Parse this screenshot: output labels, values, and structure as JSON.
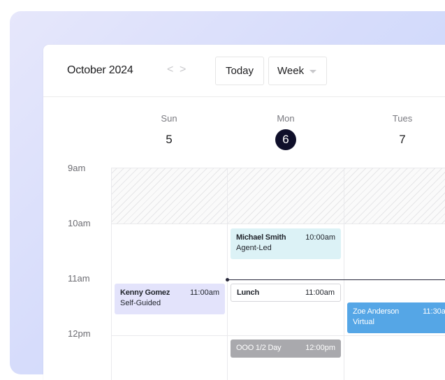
{
  "header": {
    "month_title": "October 2024",
    "prev_glyph": "<",
    "next_glyph": ">",
    "today_label": "Today",
    "view_label": "Week"
  },
  "days": [
    {
      "name": "Sun",
      "number": "5",
      "is_today": false
    },
    {
      "name": "Mon",
      "number": "6",
      "is_today": true
    },
    {
      "name": "Tues",
      "number": "7",
      "is_today": false
    }
  ],
  "time_slots": [
    "9am",
    "10am",
    "11am",
    "12pm"
  ],
  "events": {
    "michael": {
      "name": "Michael Smith",
      "time": "10:00am",
      "type": "Agent-Led"
    },
    "kenny": {
      "name": "Kenny Gomez",
      "time": "11:00am",
      "type": "Self-Guided"
    },
    "lunch": {
      "name": "Lunch",
      "time": "11:00am"
    },
    "zoe": {
      "name": "Zoe Anderson",
      "time": "11:30a",
      "type": "Virtual"
    },
    "ooo": {
      "name": "OOO 1/2 Day",
      "time": "12:00pm"
    }
  },
  "colors": {
    "today_badge": "#0f0f2a",
    "agent_led": "#dcf2f6",
    "self_guided": "#e3e3fb",
    "virtual": "#55a6e6",
    "out_of_office": "#a9a9ad",
    "current_time_line": "#27273a"
  },
  "icons": {
    "prev": "chevron-left-icon",
    "next": "chevron-right-icon",
    "view_dropdown": "chevron-down-icon"
  }
}
